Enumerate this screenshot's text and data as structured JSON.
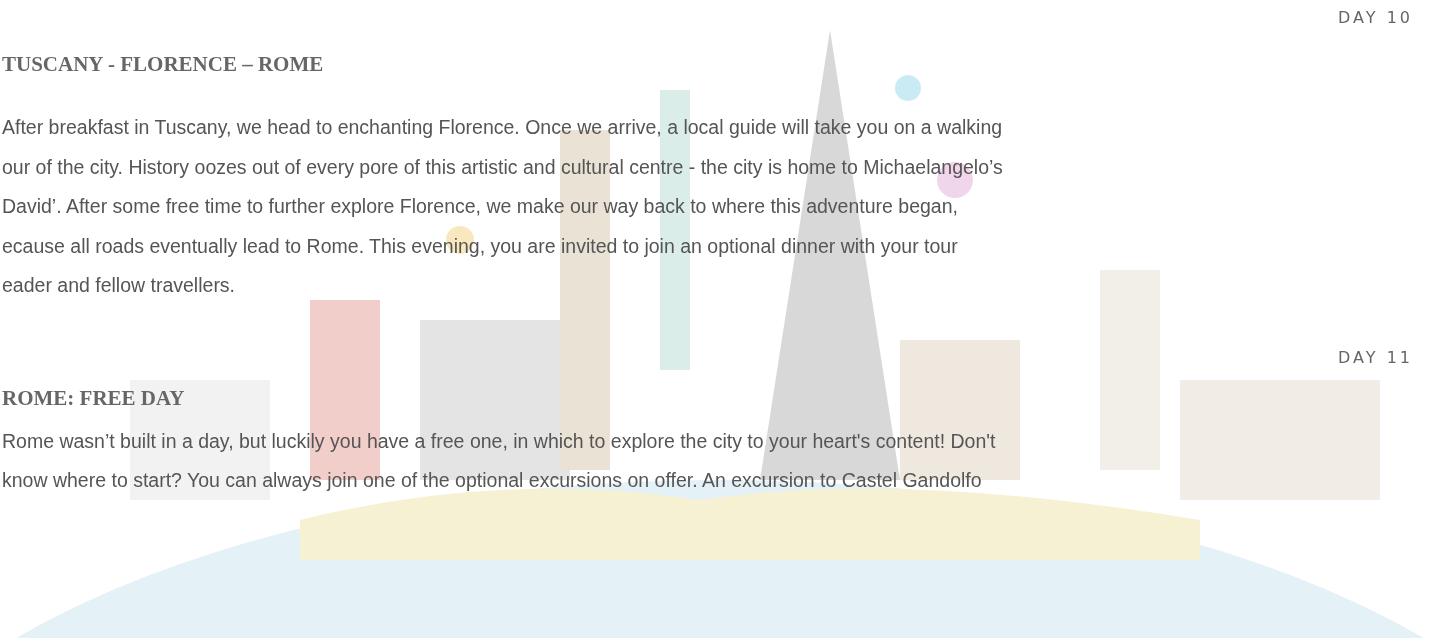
{
  "days": [
    {
      "label": "DAY 10",
      "title": "TUSCANY - FLORENCE – ROME",
      "lines": [
        "After breakfast in Tuscany, we head to enchanting Florence. Once we arrive, a local guide will take you on a walking",
        "our of the city. History oozes out of every pore of this artistic and cultural centre - the city is home to Michaelangelo’s",
        "David’. After some free time to further explore Florence, we make our way back to where this adventure began,",
        "ecause all roads eventually lead to Rome. This evening, you are invited to join an optional dinner with your tour",
        "eader and fellow travellers."
      ]
    },
    {
      "label": "DAY 11",
      "title": "ROME: FREE DAY",
      "lines": [
        "Rome wasn’t built in a day, but luckily you have a free one, in which to explore the city to your heart's content! Don't",
        "know where to start? You can always join one of the optional excursions on offer. An excursion to Castel Gandolfo"
      ]
    }
  ]
}
